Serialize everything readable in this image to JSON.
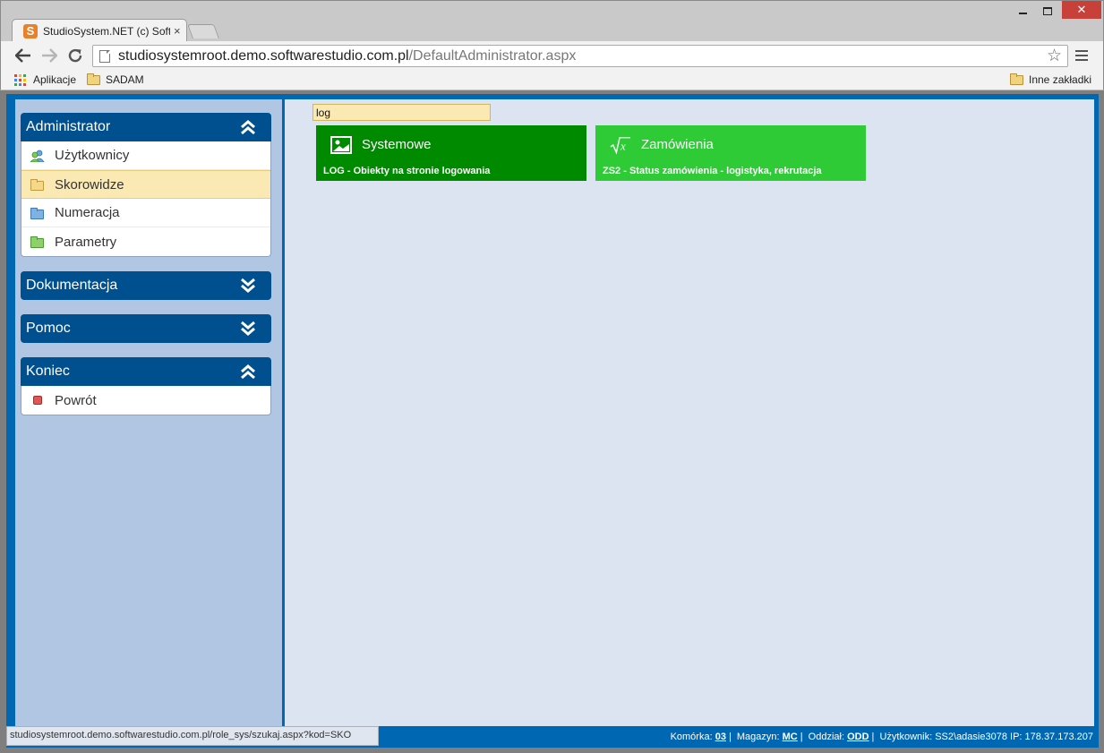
{
  "browser": {
    "tab_title": "StudioSystem.NET (c) Soft",
    "tab_close": "×",
    "url_host": "studiosystemroot.demo.softwarestudio.com.pl",
    "url_path": "/DefaultAdministrator.aspx",
    "bookmarks": {
      "apps": "Aplikacje",
      "sadam": "SADAM",
      "other": "Inne zakładki"
    }
  },
  "sidebar": {
    "administrator": {
      "title": "Administrator",
      "items": [
        "Użytkownicy",
        "Skorowidze",
        "Numeracja",
        "Parametry"
      ]
    },
    "dokumentacja": {
      "title": "Dokumentacja"
    },
    "pomoc": {
      "title": "Pomoc"
    },
    "koniec": {
      "title": "Koniec",
      "items": [
        "Powrót"
      ]
    }
  },
  "search": {
    "value": "log"
  },
  "tiles": [
    {
      "title": "Systemowe",
      "description": "LOG - Obiekty na stronie logowania",
      "color": "#008a00"
    },
    {
      "title": "Zamówienia",
      "description": "ZS2 - Status zamówienia - logistyka, rekrutacja",
      "color": "#2ecb37"
    }
  ],
  "status": {
    "hover_url": "studiosystemroot.demo.softwarestudio.com.pl/role_sys/szukaj.aspx?kod=SKO",
    "komorka_label": "Komórka:",
    "komorka_value": "03",
    "magazyn_label": "Magazyn:",
    "magazyn_value": "MC",
    "oddzial_label": "Oddział:",
    "oddzial_value": "ODD",
    "uzytkownik_label": "Użytkownik:",
    "uzytkownik_value": "SS2\\adasie3078",
    "ip_label": "IP:",
    "ip_value": "178.37.173.207"
  },
  "colors": {
    "header_blue": "#004f8f",
    "frame_blue": "#0068b3",
    "selected_item": "#fbe9b3"
  }
}
